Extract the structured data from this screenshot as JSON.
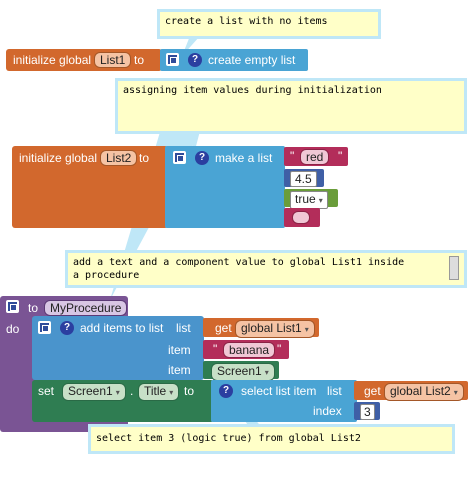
{
  "comments": {
    "c1": "create a list with no items",
    "c2": "assigning item values during initialization",
    "c3": "add a text and a component value to global List1 inside\na procedure",
    "c4": "select item 3 (logic true) from global List2"
  },
  "block1": {
    "prefix": "initialize global",
    "name": "List1",
    "to": "to",
    "value": "create empty list"
  },
  "block2": {
    "prefix": "initialize global",
    "name": "List2",
    "to": "to",
    "make": "make a list",
    "items": [
      "red",
      "4.5",
      "true",
      ""
    ]
  },
  "procedure": {
    "to": "to",
    "name": "MyProcedure",
    "do": "do",
    "add_items": "add items to list",
    "list_label": "list",
    "get": "get",
    "get_var": "global List1",
    "item_label": "item",
    "item_text": "banana",
    "item_component": "Screen1",
    "set": "set",
    "set_component": "Screen1",
    "dot": ".",
    "set_prop": "Title",
    "to_label": "to",
    "select": "select list item",
    "select_list_label": "list",
    "select_get": "get",
    "select_var": "global List2",
    "index_label": "index",
    "index_value": "3"
  },
  "icons": {
    "dropdown": "dropdown-arrow-icon",
    "mutator": "gear-mutator-icon",
    "help": "question-icon"
  }
}
